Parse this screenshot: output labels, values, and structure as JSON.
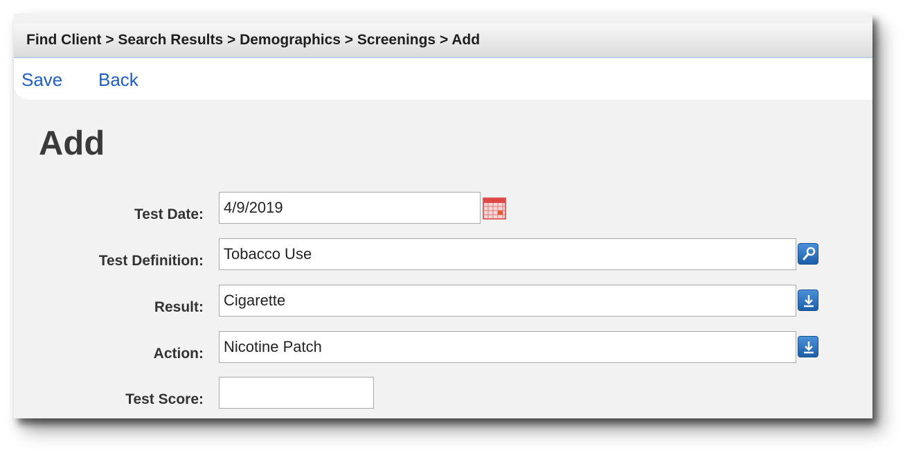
{
  "breadcrumb": "Find Client > Search Results > Demographics > Screenings > Add",
  "actions": {
    "save_label": "Save",
    "back_label": "Back"
  },
  "page_title": "Add",
  "form": {
    "test_date": {
      "label": "Test Date:",
      "value": "4/9/2019"
    },
    "test_definition": {
      "label": "Test Definition:",
      "value": "Tobacco Use"
    },
    "result": {
      "label": "Result:",
      "value": "Cigarette"
    },
    "action": {
      "label": "Action:",
      "value": "Nicotine Patch"
    },
    "test_score": {
      "label": "Test Score:",
      "value": ""
    }
  },
  "icons": {
    "calendar": "calendar-icon",
    "lookup": "search-icon",
    "dropdown": "download-arrow-icon"
  },
  "colors": {
    "link": "#1f5fbf",
    "button": "#2a73c2",
    "calendar": "#e03a3a"
  }
}
